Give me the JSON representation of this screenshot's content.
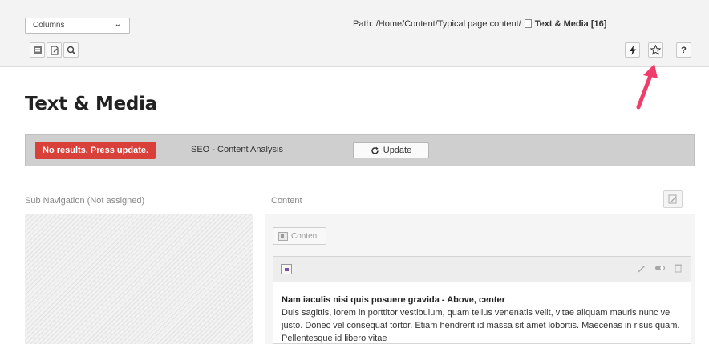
{
  "toolbar": {
    "view_select": "Columns",
    "path_label": "Path: /Home/Content/Typical page content/",
    "page_ref": "Text & Media [16]",
    "buttons": [
      "list-view",
      "edit-page",
      "search"
    ],
    "right_buttons": [
      "clear-cache",
      "bookmark",
      "help"
    ]
  },
  "page": {
    "title": "Text & Media"
  },
  "seo": {
    "badge": "No results. Press update.",
    "label": "SEO - Content Analysis",
    "update_label": "Update"
  },
  "columns": {
    "left_header": "Sub Navigation (Not assigned)",
    "right_header": "Content",
    "add_content_label": "Content"
  },
  "content_element": {
    "title": "Nam iaculis nisi quis posuere gravida - Above, center",
    "text": "Duis sagittis, lorem in porttitor vestibulum, quam tellus venenatis velit, vitae aliquam mauris nunc vel justo. Donec vel consequat tortor. Etiam hendrerit id massa sit amet lobortis. Maecenas in risus quam. Pellentesque id libero vitae"
  },
  "colors": {
    "badge_red": "#d9403a",
    "arrow_pink": "#ef3e6b",
    "seo_bar": "#cfcfcf"
  }
}
